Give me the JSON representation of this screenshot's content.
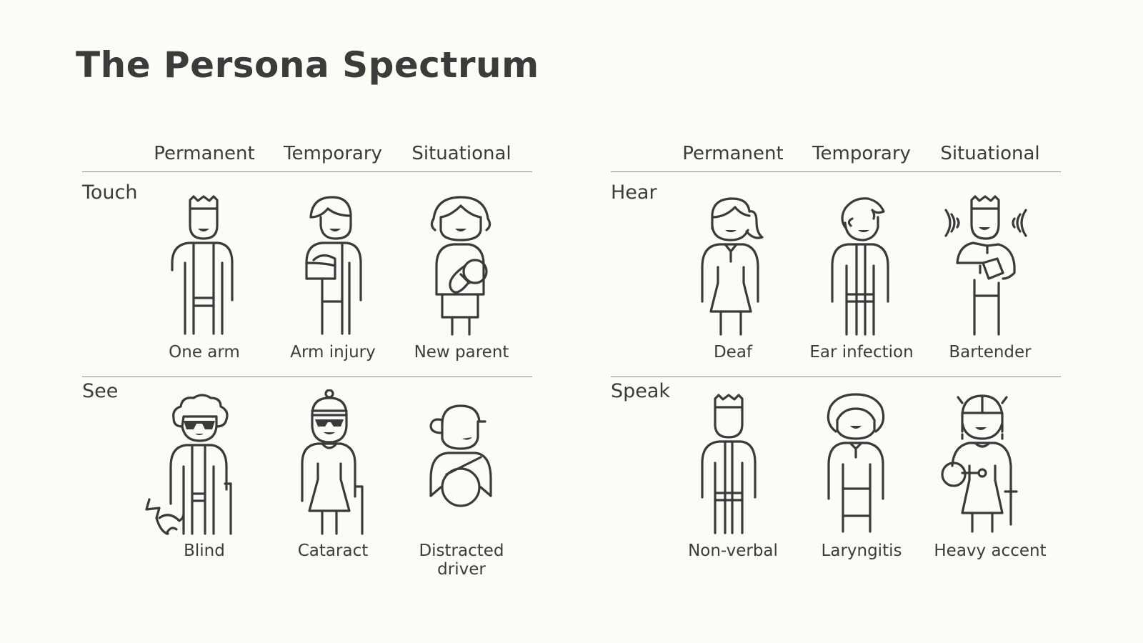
{
  "title": "The Persona Spectrum",
  "columns": [
    "Permanent",
    "Temporary",
    "Situational"
  ],
  "panels": {
    "left": {
      "rows": [
        {
          "category": "Touch",
          "personas": [
            "One arm",
            "Arm injury",
            "New parent"
          ]
        },
        {
          "category": "See",
          "personas": [
            "Blind",
            "Cataract",
            "Distracted driver"
          ]
        }
      ]
    },
    "right": {
      "rows": [
        {
          "category": "Hear",
          "personas": [
            "Deaf",
            "Ear infection",
            "Bartender"
          ]
        },
        {
          "category": "Speak",
          "personas": [
            "Non-verbal",
            "Laryngitis",
            "Heavy accent"
          ]
        }
      ]
    }
  },
  "icons": {
    "touch": [
      "one-arm-icon",
      "arm-injury-icon",
      "new-parent-icon"
    ],
    "see": [
      "blind-icon",
      "cataract-icon",
      "distracted-driver-icon"
    ],
    "hear": [
      "deaf-icon",
      "ear-infection-icon",
      "bartender-icon"
    ],
    "speak": [
      "non-verbal-icon",
      "laryngitis-icon",
      "heavy-accent-icon"
    ]
  },
  "colors": {
    "background": "#fcfbf5",
    "ink": "#3a3a3a",
    "rule": "#8a8a8a"
  }
}
